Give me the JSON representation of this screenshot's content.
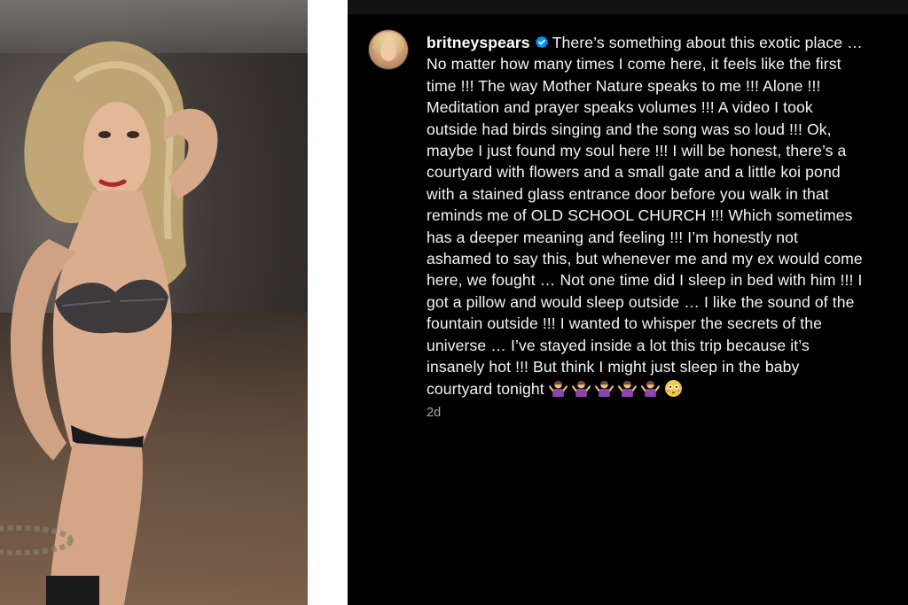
{
  "post": {
    "username": "britneyspears",
    "caption_lines": [
      "There’s something about this exotic place …",
      "No matter how many times I come here, it feels like the first",
      "time !!! The way Mother Nature speaks to me !!! Alone !!!",
      "Meditation and prayer speaks volumes !!! A video I took",
      "outside had birds singing and the song was so loud !!! Ok,",
      "maybe I just found my soul here !!! I will be honest, there’s a",
      "courtyard with flowers and a small gate and a little koi pond",
      "with a stained glass entrance door before you walk in that",
      "reminds me of OLD SCHOOL CHURCH !!! Which sometimes",
      "has a deeper meaning and feeling !!! I’m honestly not",
      "ashamed to say this, but whenever me and my ex would come",
      "here, we fought … Not one time did I sleep in bed with him !!! I",
      "got a pillow and would sleep outside … I like the sound of the",
      "fountain outside !!! I wanted to whisper the secrets of the",
      "universe … I’ve stayed inside a lot this trip because it’s",
      "insanely hot !!! But think I might just sleep in the baby",
      "courtyard tonight"
    ],
    "emojis": [
      "person-shrugging-emoji",
      "person-shrugging-emoji",
      "person-shrugging-emoji",
      "person-shrugging-emoji",
      "person-shrugging-emoji",
      "flushed-face-emoji"
    ],
    "timestamp": "2d",
    "colors": {
      "background": "#000000",
      "text": "#f5f5f5",
      "timestamp": "#a8a8a8",
      "verified_badge": "#0095f6",
      "shrug_emoji": "#8e44ad",
      "flushed_emoji": "#f7c948"
    }
  },
  "photo": {
    "description_icon": "photo-image"
  }
}
